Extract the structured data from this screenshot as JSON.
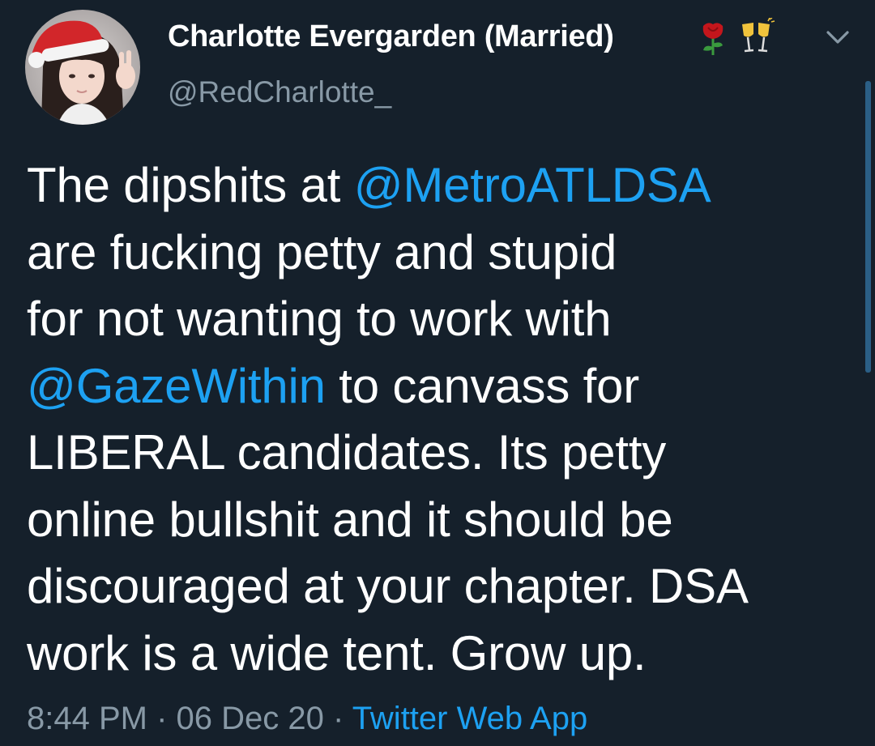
{
  "author": {
    "display_name": "Charlotte Evergarden (Married)",
    "handle": "@RedCharlotte_",
    "emoji_1": "rose",
    "emoji_2": "clinking-glasses"
  },
  "tweet": {
    "line1_pre": "The dipshits at ",
    "mention1": "@MetroATLDSA",
    "line2": "are fucking petty and stupid",
    "line3": "for not wanting to work with",
    "mention2": "@GazeWithin",
    "line4_post": " to canvass for",
    "line5": "LIBERAL candidates. Its petty",
    "line6": "online bullshit and it should be",
    "line7": "discouraged at your chapter. DSA",
    "line8": "work is a wide tent. Grow up."
  },
  "meta": {
    "time": "8:44 PM",
    "sep1": " · ",
    "date": "06 Dec 20",
    "sep2": " · ",
    "source": "Twitter Web App"
  },
  "colors": {
    "background": "#15202b",
    "link": "#1da1f2",
    "secondary": "#8899a6"
  }
}
